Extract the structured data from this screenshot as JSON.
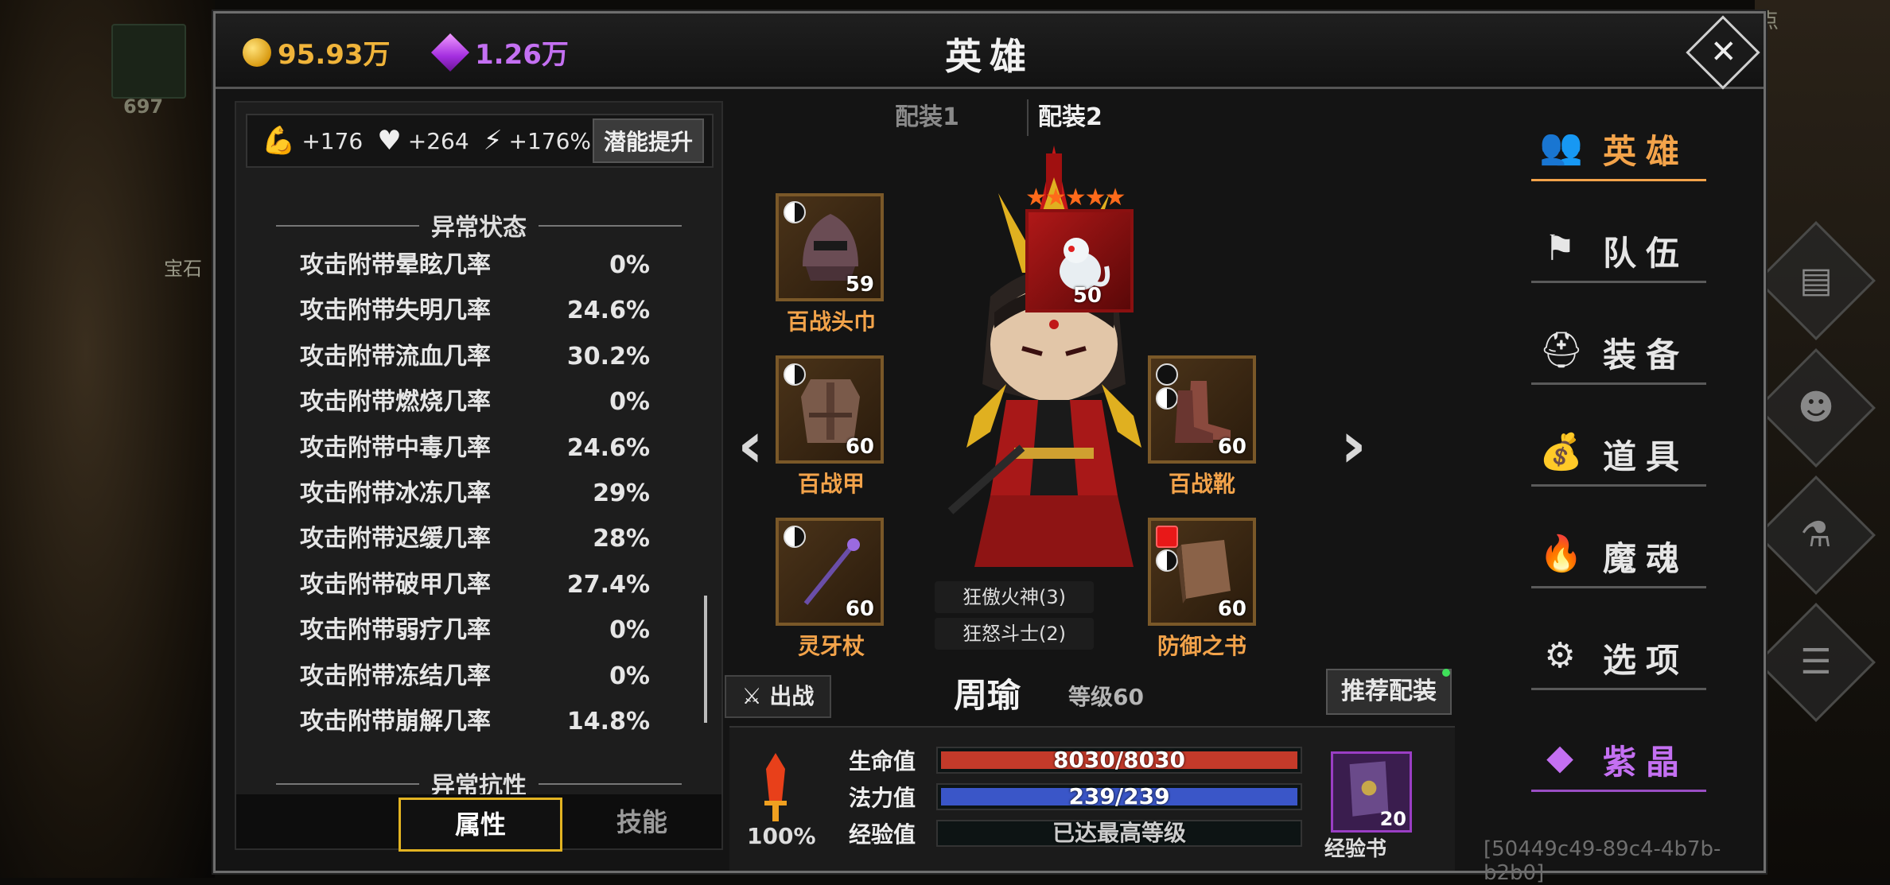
{
  "currency": {
    "gold": "95.93万",
    "gem": "1.26万"
  },
  "title": "英雄",
  "background": {
    "slot_count": "697",
    "gem_label": "宝石",
    "corner_text": "点"
  },
  "stat_bar": {
    "strength": "+176",
    "vitality": "+264",
    "agility": "+176%",
    "potential_button": "潜能提升"
  },
  "abnormal_status": {
    "heading": "异常状态",
    "rows": [
      {
        "name": "攻击附带晕眩几率",
        "value": "0%"
      },
      {
        "name": "攻击附带失明几率",
        "value": "24.6%"
      },
      {
        "name": "攻击附带流血几率",
        "value": "30.2%"
      },
      {
        "name": "攻击附带燃烧几率",
        "value": "0%"
      },
      {
        "name": "攻击附带中毒几率",
        "value": "24.6%"
      },
      {
        "name": "攻击附带冰冻几率",
        "value": "29%"
      },
      {
        "name": "攻击附带迟缓几率",
        "value": "28%"
      },
      {
        "name": "攻击附带破甲几率",
        "value": "27.4%"
      },
      {
        "name": "攻击附带弱疗几率",
        "value": "0%"
      },
      {
        "name": "攻击附带冻结几率",
        "value": "0%"
      },
      {
        "name": "攻击附带崩解几率",
        "value": "14.8%"
      }
    ],
    "next_heading": "异常抗性"
  },
  "bottom_tabs": {
    "attributes": "属性",
    "skills": "技能"
  },
  "loadouts": {
    "one": "配装1",
    "two": "配装2"
  },
  "equipment": {
    "helmet": {
      "name": "百战头巾",
      "level": "59"
    },
    "armor": {
      "name": "百战甲",
      "level": "60"
    },
    "weapon": {
      "name": "灵牙杖",
      "level": "60"
    },
    "pet": {
      "level": "50",
      "stars": "★★★★★"
    },
    "boots": {
      "name": "百战靴",
      "level": "60"
    },
    "book": {
      "name": "防御之书",
      "level": "60"
    }
  },
  "set_bonuses": {
    "one": "狂傲火神(3)",
    "two": "狂怒斗士(2)"
  },
  "hero": {
    "sortie": "出战",
    "name": "周瑜",
    "level": "等级60",
    "recommend": "推荐配装"
  },
  "vitals": {
    "rage_pct": "100%",
    "hp": {
      "label": "生命值",
      "text": "8030/8030",
      "fraction": 1.0
    },
    "mp": {
      "label": "法力值",
      "text": "239/239",
      "fraction": 1.0
    },
    "exp": {
      "label": "经验值",
      "text": "已达最高等级",
      "fraction": 0.0
    },
    "exp_book": {
      "count": "20",
      "label": "经验书"
    }
  },
  "menu": [
    {
      "label": "英雄",
      "icon": "heroes-icon"
    },
    {
      "label": "队伍",
      "icon": "flag-icon"
    },
    {
      "label": "装备",
      "icon": "helmet-icon"
    },
    {
      "label": "道具",
      "icon": "bag-icon"
    },
    {
      "label": "魔魂",
      "icon": "flame-icon"
    },
    {
      "label": "选项",
      "icon": "gear-icon"
    },
    {
      "label": "紫晶",
      "icon": "crystal-icon"
    }
  ],
  "uuid": "[50449c49-89c4-4b7b-b2b0]",
  "colors": {
    "accent": "#f3a34a",
    "gold": "#f0b43a",
    "gem": "#c470f2",
    "hp": "#c43a2a",
    "mp": "#3a56c8"
  }
}
